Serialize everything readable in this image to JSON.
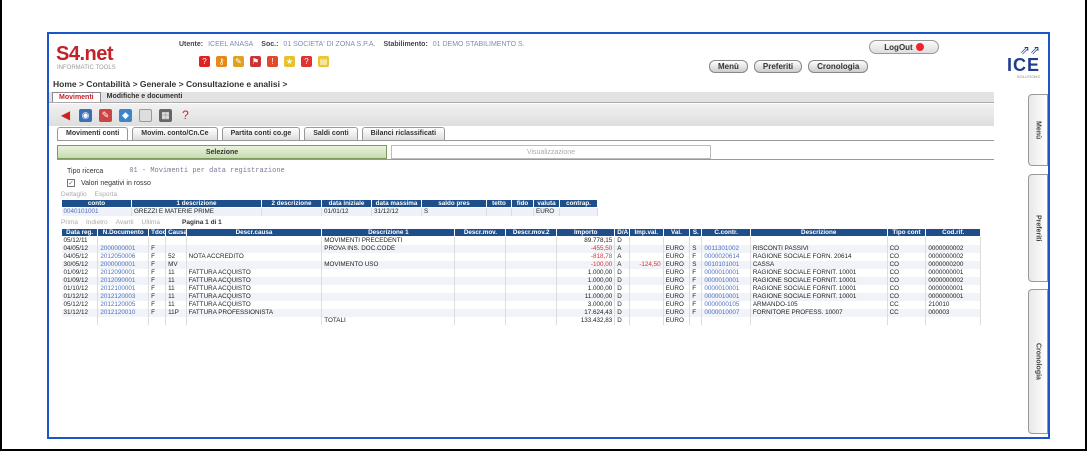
{
  "header": {
    "logo": "S4.net",
    "logo_sub": "INFORMATIC TOOLS",
    "user_label": "Utente:",
    "user_value": "ICEEL ANASA",
    "company_label": "Soc.:",
    "company_value": "01  SOCIETA' DI ZONA S.P.A.",
    "plant_label": "Stabilimento:",
    "plant_value": "01  DEMO STABILIMENTO S.",
    "logout": "LogOut",
    "nav": [
      "Menù",
      "Preferiti",
      "Cronologia"
    ],
    "brand": "ICE",
    "brand_sub": "SOLUTIONS"
  },
  "breadcrumb": "Home > Contabilità > Generale > Consultazione e analisi >",
  "top_tabs": [
    "Movimenti",
    "Modifiche e documenti"
  ],
  "sub_tabs": [
    "Movimenti conti",
    "Movim. conto/Cn.Ce",
    "Partita conti co.ge",
    "Saldi conti",
    "Bilanci riclassificati"
  ],
  "section_tabs": {
    "selection": "Selezione",
    "display": "Visualizzazione"
  },
  "filter": {
    "label": "Tipo ricerca",
    "value": "01 - Movimenti per data registrazione",
    "checkbox_label": "Valori negativi in rosso",
    "links": [
      "Dettaglio",
      "Esporta"
    ]
  },
  "account_table": {
    "headers": [
      "conto",
      "1 descrizione",
      "2 descrizione",
      "data iniziale",
      "data massima",
      "saldo pres",
      "tetto",
      "fido",
      "valuta",
      "contrap."
    ],
    "row": [
      "0040101001",
      "GREZZI E MATERIE PRIME",
      "",
      "01/01/12",
      "31/12/12",
      "S",
      "",
      "",
      "EURO",
      ""
    ]
  },
  "pager": {
    "links": [
      "Prima",
      "Indietro",
      "Avanti",
      "Ultima"
    ],
    "text": "Pagina 1 di 1"
  },
  "movements": {
    "headers": [
      "Data reg.",
      "N.Documento",
      "Tdoc",
      "Causa",
      "Descr.causa",
      "Descrizione 1",
      "Descr.mov.",
      "Descr.mov.2",
      "Importo",
      "D/A",
      "Imp.val.",
      "Val.",
      "S.",
      "C.contr.",
      "Descrizione",
      "Tipo cont",
      "Cod.rif."
    ],
    "rows": [
      [
        "05/12/11",
        "",
        "",
        "",
        "",
        "MOVIMENTI PRECEDENTI",
        "",
        "",
        "89.778,15",
        "D",
        "",
        "",
        "",
        "",
        "",
        "",
        ""
      ],
      [
        "04/05/12",
        "2000000001",
        "F",
        "",
        "",
        "PROVA INS. DOC.CODE",
        "",
        "",
        "-455,50",
        "A",
        "",
        "EURO",
        "S",
        "0011301002",
        "RISCONTI PASSIVI",
        "CO",
        "0000000002"
      ],
      [
        "04/05/12",
        "2012050006",
        "F",
        "52",
        "NOTA ACCREDITO",
        "",
        "",
        "",
        "-818,78",
        "A",
        "",
        "EURO",
        "F",
        "0000020614",
        "RAGIONE SOCIALE FORN. 20614",
        "CO",
        "0000000002"
      ],
      [
        "30/05/12",
        "2000000001",
        "F",
        "MV",
        "",
        "MOVIMENTO USO",
        "",
        "",
        "-100,00",
        "A",
        "-124,50",
        "EURO",
        "S",
        "0010101001",
        "CASSA",
        "CO",
        "0000000200"
      ],
      [
        "01/09/12",
        "2012090001",
        "F",
        "11",
        "FATTURA ACQUISTO",
        "",
        "",
        "",
        "1.000,00",
        "D",
        "",
        "EURO",
        "F",
        "0000010001",
        "RAGIONE SOCIALE FORNIT. 10001",
        "CO",
        "0000000001"
      ],
      [
        "01/09/12",
        "2012090001",
        "F",
        "11",
        "FATTURA ACQUISTO",
        "",
        "",
        "",
        "1.000,00",
        "D",
        "",
        "EURO",
        "F",
        "0000010001",
        "RAGIONE SOCIALE FORNIT. 10001",
        "CO",
        "0000000002"
      ],
      [
        "01/10/12",
        "2012100001",
        "F",
        "11",
        "FATTURA ACQUISTO",
        "",
        "",
        "",
        "1.000,00",
        "D",
        "",
        "EURO",
        "F",
        "0000010001",
        "RAGIONE SOCIALE FORNIT. 10001",
        "CO",
        "0000000001"
      ],
      [
        "01/12/12",
        "2012120003",
        "F",
        "11",
        "FATTURA ACQUISTO",
        "",
        "",
        "",
        "11.000,00",
        "D",
        "",
        "EURO",
        "F",
        "0000010001",
        "RAGIONE SOCIALE FORNIT. 10001",
        "CO",
        "0000000001"
      ],
      [
        "05/12/12",
        "2012120005",
        "F",
        "11",
        "FATTURA ACQUISTO",
        "",
        "",
        "",
        "3.000,00",
        "D",
        "",
        "EURO",
        "F",
        "0000000105",
        "ARMANDO-105",
        "CC",
        "210010"
      ],
      [
        "31/12/12",
        "2012120010",
        "F",
        "11P",
        "FATTURA PROFESSIONISTA",
        "",
        "",
        "",
        "17.624,43",
        "D",
        "",
        "EURO",
        "F",
        "0000010007",
        "FORNITORE PROFESS. 10007",
        "CC",
        "000003"
      ],
      [
        "",
        "",
        "",
        "",
        "",
        "TOTALI",
        "",
        "",
        "133.432,83",
        "D",
        "",
        "EURO",
        "",
        "",
        "",
        "",
        ""
      ]
    ]
  },
  "side_tabs": [
    "Menù",
    "Preferiti",
    "Cronologia"
  ]
}
